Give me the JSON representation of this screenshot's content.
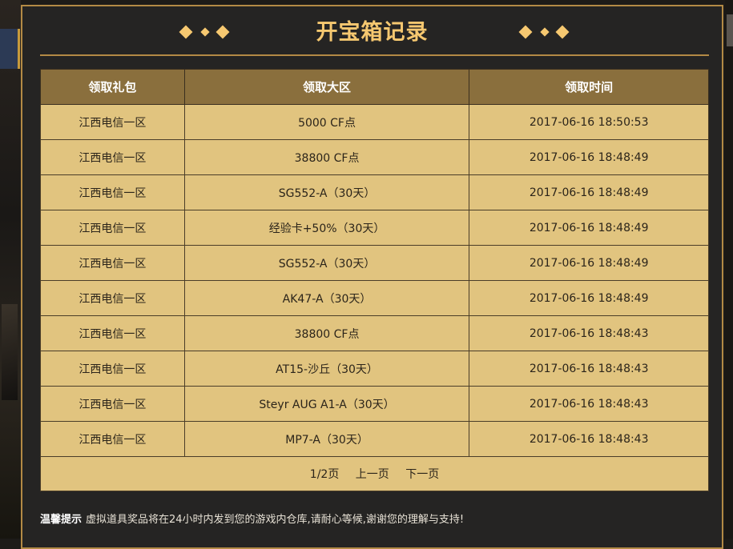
{
  "title": "开宝箱记录",
  "colors": {
    "accent": "#f6c870",
    "border": "#b38a45",
    "header_bg": "#8a6f3d",
    "row_bg": "#e1c47f",
    "panel_bg": "#252423"
  },
  "table": {
    "headers": [
      "领取礼包",
      "领取大区",
      "领取时间"
    ],
    "rows": [
      [
        "江西电信一区",
        "5000 CF点",
        "2017-06-16 18:50:53"
      ],
      [
        "江西电信一区",
        "38800 CF点",
        "2017-06-16 18:48:49"
      ],
      [
        "江西电信一区",
        "SG552-A（30天）",
        "2017-06-16 18:48:49"
      ],
      [
        "江西电信一区",
        "经验卡+50%（30天）",
        "2017-06-16 18:48:49"
      ],
      [
        "江西电信一区",
        "SG552-A（30天）",
        "2017-06-16 18:48:49"
      ],
      [
        "江西电信一区",
        "AK47-A（30天）",
        "2017-06-16 18:48:49"
      ],
      [
        "江西电信一区",
        "38800 CF点",
        "2017-06-16 18:48:43"
      ],
      [
        "江西电信一区",
        "AT15-沙丘（30天）",
        "2017-06-16 18:48:43"
      ],
      [
        "江西电信一区",
        "Steyr AUG A1-A（30天）",
        "2017-06-16 18:48:43"
      ],
      [
        "江西电信一区",
        "MP7-A（30天）",
        "2017-06-16 18:48:43"
      ]
    ]
  },
  "pager": {
    "page_info": "1/2页",
    "prev": "上一页",
    "next": "下一页"
  },
  "notice": {
    "label": "温馨提示",
    "text": "虚拟道具奖品将在24小时内发到您的游戏内仓库,请耐心等候,谢谢您的理解与支持!"
  }
}
